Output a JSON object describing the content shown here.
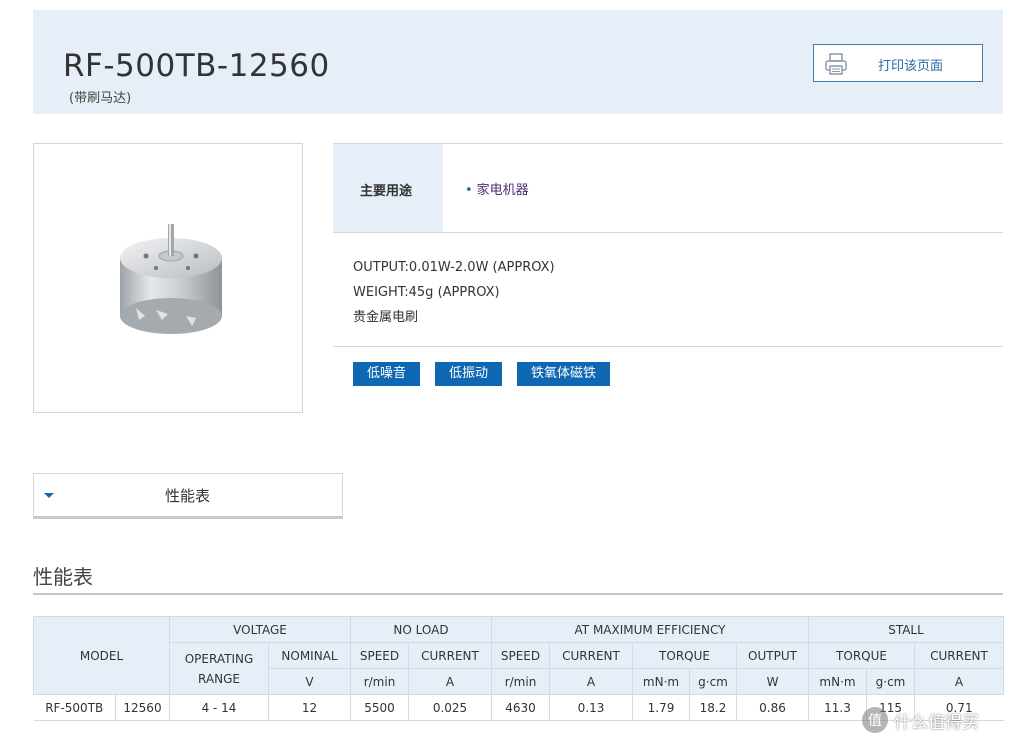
{
  "header": {
    "title": "RF-500TB-12560",
    "subtitle": "(带刷马达)",
    "print_label": "打印该页面"
  },
  "main_use": {
    "label": "主要用途",
    "item": "家电机器"
  },
  "specs": {
    "lines": [
      "OUTPUT:0.01W-2.0W (APPROX)",
      "WEIGHT:45g (APPROX)",
      "贵金属电刷"
    ]
  },
  "tags": [
    "低噪音",
    "低振动",
    "铁氧体磁铁"
  ],
  "accordion": {
    "label": "性能表"
  },
  "section": {
    "title": "性能表"
  },
  "table": {
    "group_headers": {
      "model": "MODEL",
      "voltage": "VOLTAGE",
      "no_load": "NO LOAD",
      "max_eff": "AT MAXIMUM EFFICIENCY",
      "stall": "STALL"
    },
    "sub_headers": {
      "operating_range": "OPERATING RANGE",
      "nominal": "NOMINAL",
      "speed": "SPEED",
      "current": "CURRENT",
      "torque": "TORQUE",
      "output": "OUTPUT"
    },
    "units": {
      "nominal": "V",
      "nl_speed": "r/min",
      "nl_current": "A",
      "me_speed": "r/min",
      "me_current": "A",
      "me_torque_mnm": "mN·m",
      "me_torque_gcm": "g·cm",
      "me_output": "W",
      "st_torque_mnm": "mN·m",
      "st_torque_gcm": "g·cm",
      "st_current": "A"
    },
    "row": {
      "model": "RF-500TB",
      "variant": "12560",
      "operating_range": "4 - 14",
      "nominal": "12",
      "nl_speed": "5500",
      "nl_current": "0.025",
      "me_speed": "4630",
      "me_current": "0.13",
      "me_torque_mnm": "1.79",
      "me_torque_gcm": "18.2",
      "me_output": "0.86",
      "st_torque_mnm": "11.3",
      "st_torque_gcm": "115",
      "st_current": "0.71"
    }
  },
  "watermark": {
    "icon_text": "值",
    "text": "什么值得买"
  }
}
